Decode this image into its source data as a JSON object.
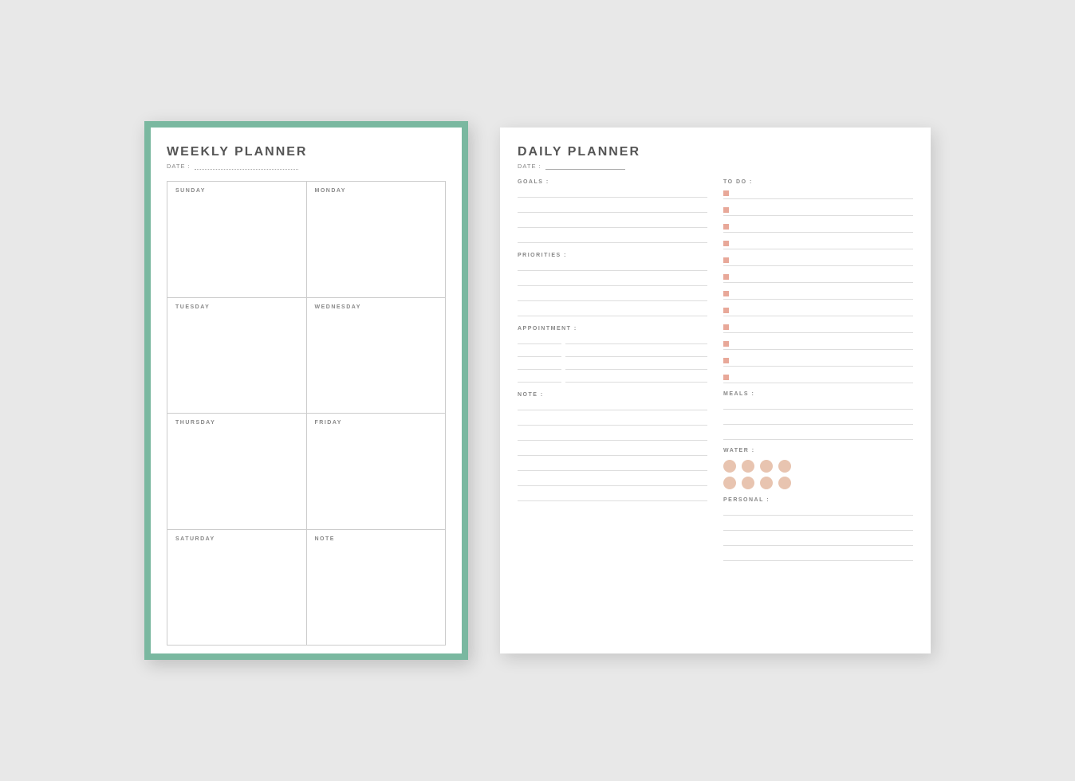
{
  "background": "#e8e8e8",
  "weekly": {
    "title": "WEEKLY PLANNER",
    "date_label": "DATE :",
    "border_color": "#7ab8a0",
    "days": [
      {
        "label": "SUNDAY"
      },
      {
        "label": "MONDAY"
      },
      {
        "label": "TUESDAY"
      },
      {
        "label": "WEDNESDAY"
      },
      {
        "label": "THURSDAY"
      },
      {
        "label": "FRIDAY"
      },
      {
        "label": "SATURDAY"
      },
      {
        "label": "NOTE"
      }
    ]
  },
  "daily": {
    "title": "DAILY PLANNER",
    "date_label": "DATE :",
    "sections": {
      "goals": "GOALS :",
      "priorities": "PRIORITIES :",
      "appointment": "APPOINTMENT :",
      "note": "NOTE :",
      "todo": "TO DO :",
      "meals": "MEALS :",
      "water": "WATER :",
      "personal": "PERSONAL :"
    }
  }
}
